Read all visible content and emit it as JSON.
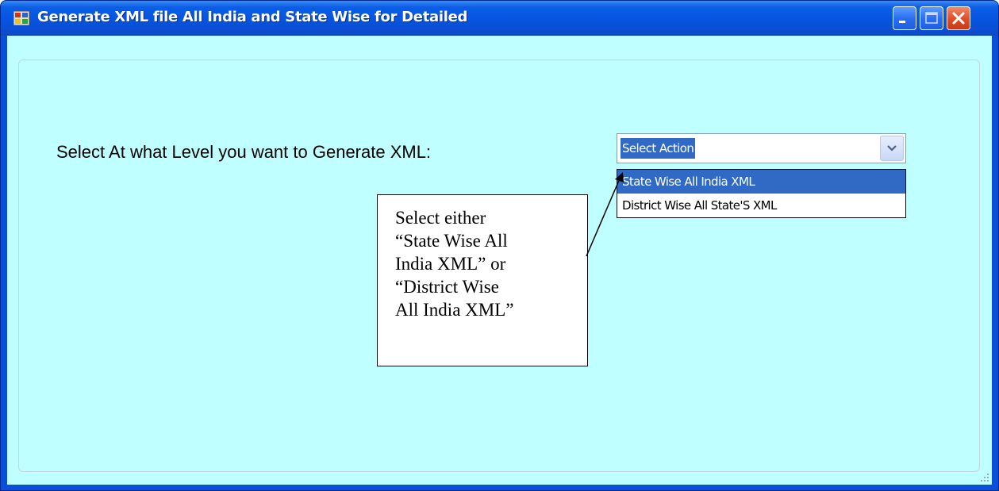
{
  "window": {
    "title": "Generate XML file All India and State Wise for Detailed",
    "icon": "app-window-icon",
    "controls": [
      "minimize-icon",
      "maximize-icon",
      "close-icon"
    ]
  },
  "form": {
    "prompt_label": "Select At what Level you want to Generate XML:",
    "combo": {
      "selected_value": "Select Action",
      "options": [
        "State Wise All India XML",
        "District Wise All State'S XML"
      ],
      "highlighted_option": "State Wise All India XML"
    }
  },
  "callout": {
    "lines": [
      "Select either",
      "“State Wise All",
      "India XML” or",
      "“District Wise",
      "All India XML”"
    ]
  },
  "colors": {
    "client_background": "#c0ffff",
    "titlebar": "#0654e0",
    "selection": "#316ac5"
  }
}
